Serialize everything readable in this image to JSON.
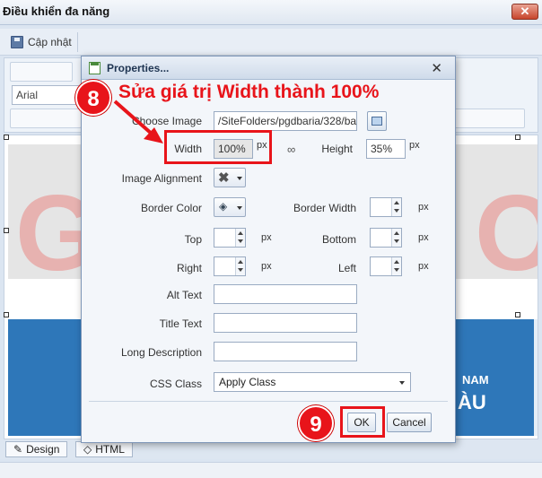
{
  "window": {
    "title": "Điều khiển đa năng",
    "close_glyph": "✕"
  },
  "toolbar": {
    "save_label": "Cập nhật",
    "save_icon": "floppy-disk-icon"
  },
  "editor": {
    "font_name": "Arial",
    "bottom_tabs": {
      "design": "Design",
      "html": "HTML"
    },
    "bg_text": {
      "left_letter": "G",
      "right_letter": "O",
      "nam": "NAM",
      "au": "ÀU"
    }
  },
  "dialog": {
    "title": "Properties...",
    "close_glyph": "✕",
    "fields": {
      "choose_image": {
        "label": "Choose Image",
        "value": "/SiteFolders/pgdbaria/328/ba"
      },
      "width": {
        "label": "Width",
        "value": "100%",
        "unit": "px"
      },
      "height": {
        "label": "Height",
        "value": "35%",
        "unit": "px"
      },
      "image_alignment": {
        "label": "Image Alignment"
      },
      "border_color": {
        "label": "Border Color"
      },
      "border_width": {
        "label": "Border Width",
        "unit": "px"
      },
      "top": {
        "label": "Top",
        "unit": "px"
      },
      "bottom": {
        "label": "Bottom",
        "unit": "px"
      },
      "right": {
        "label": "Right",
        "unit": "px"
      },
      "left": {
        "label": "Left",
        "unit": "px"
      },
      "alt_text": {
        "label": "Alt Text",
        "value": ""
      },
      "title_text": {
        "label": "Title Text",
        "value": ""
      },
      "long_description": {
        "label": "Long Description",
        "value": ""
      },
      "css_class": {
        "label": "CSS Class",
        "value": "Apply Class"
      }
    },
    "buttons": {
      "ok": "OK",
      "cancel": "Cancel"
    }
  },
  "annotations": {
    "step8": {
      "number": "8",
      "text": "Sửa giá trị Width thành 100%"
    },
    "step9": {
      "number": "9"
    },
    "color": "#e8141a"
  }
}
